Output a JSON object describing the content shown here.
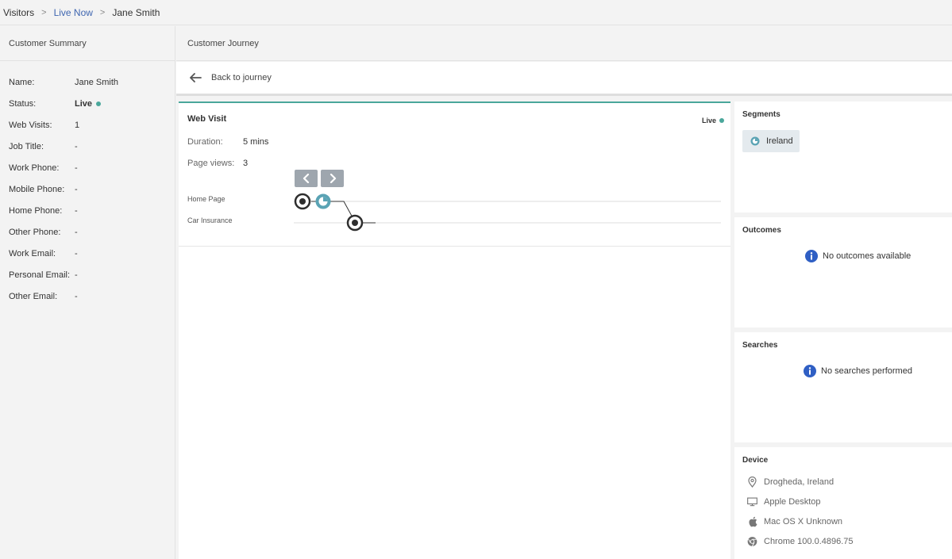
{
  "breadcrumb": {
    "items": [
      "Visitors",
      "Live Now",
      "Jane Smith"
    ],
    "separator": ">"
  },
  "customer_summary": {
    "title": "Customer Summary",
    "fields": [
      {
        "label": "Name:",
        "value": "Jane Smith"
      },
      {
        "label": "Status:",
        "value": "Live"
      },
      {
        "label": "Web Visits:",
        "value": "1"
      },
      {
        "label": "Job Title:",
        "value": "-"
      },
      {
        "label": "Work Phone:",
        "value": "-"
      },
      {
        "label": "Mobile Phone:",
        "value": "-"
      },
      {
        "label": "Home Phone:",
        "value": "-"
      },
      {
        "label": "Other Phone:",
        "value": "-"
      },
      {
        "label": "Work Email:",
        "value": "-"
      },
      {
        "label": "Personal Email:",
        "value": "-"
      },
      {
        "label": "Other Email:",
        "value": "-"
      }
    ]
  },
  "journey": {
    "title": "Customer Journey",
    "back_label": "Back to journey"
  },
  "web_visit": {
    "title": "Web Visit",
    "status": "Live",
    "duration_label": "Duration:",
    "duration_value": "5 mins",
    "pageviews_label": "Page views:",
    "pageviews_value": "3",
    "pages": [
      "Home Page",
      "Car Insurance"
    ]
  },
  "segments": {
    "title": "Segments",
    "items": [
      "Ireland"
    ]
  },
  "outcomes": {
    "title": "Outcomes",
    "empty_message": "No outcomes available"
  },
  "searches": {
    "title": "Searches",
    "empty_message": "No searches performed"
  },
  "device": {
    "title": "Device",
    "items": [
      {
        "icon": "location-pin-icon",
        "text": "Drogheda, Ireland"
      },
      {
        "icon": "desktop-icon",
        "text": "Apple Desktop"
      },
      {
        "icon": "apple-icon",
        "text": "Mac OS X Unknown"
      },
      {
        "icon": "chrome-icon",
        "text": "Chrome 100.0.4896.75"
      }
    ]
  },
  "colors": {
    "accent": "#4aa79b",
    "link": "#3f66b0",
    "info": "#2f5fc4"
  }
}
